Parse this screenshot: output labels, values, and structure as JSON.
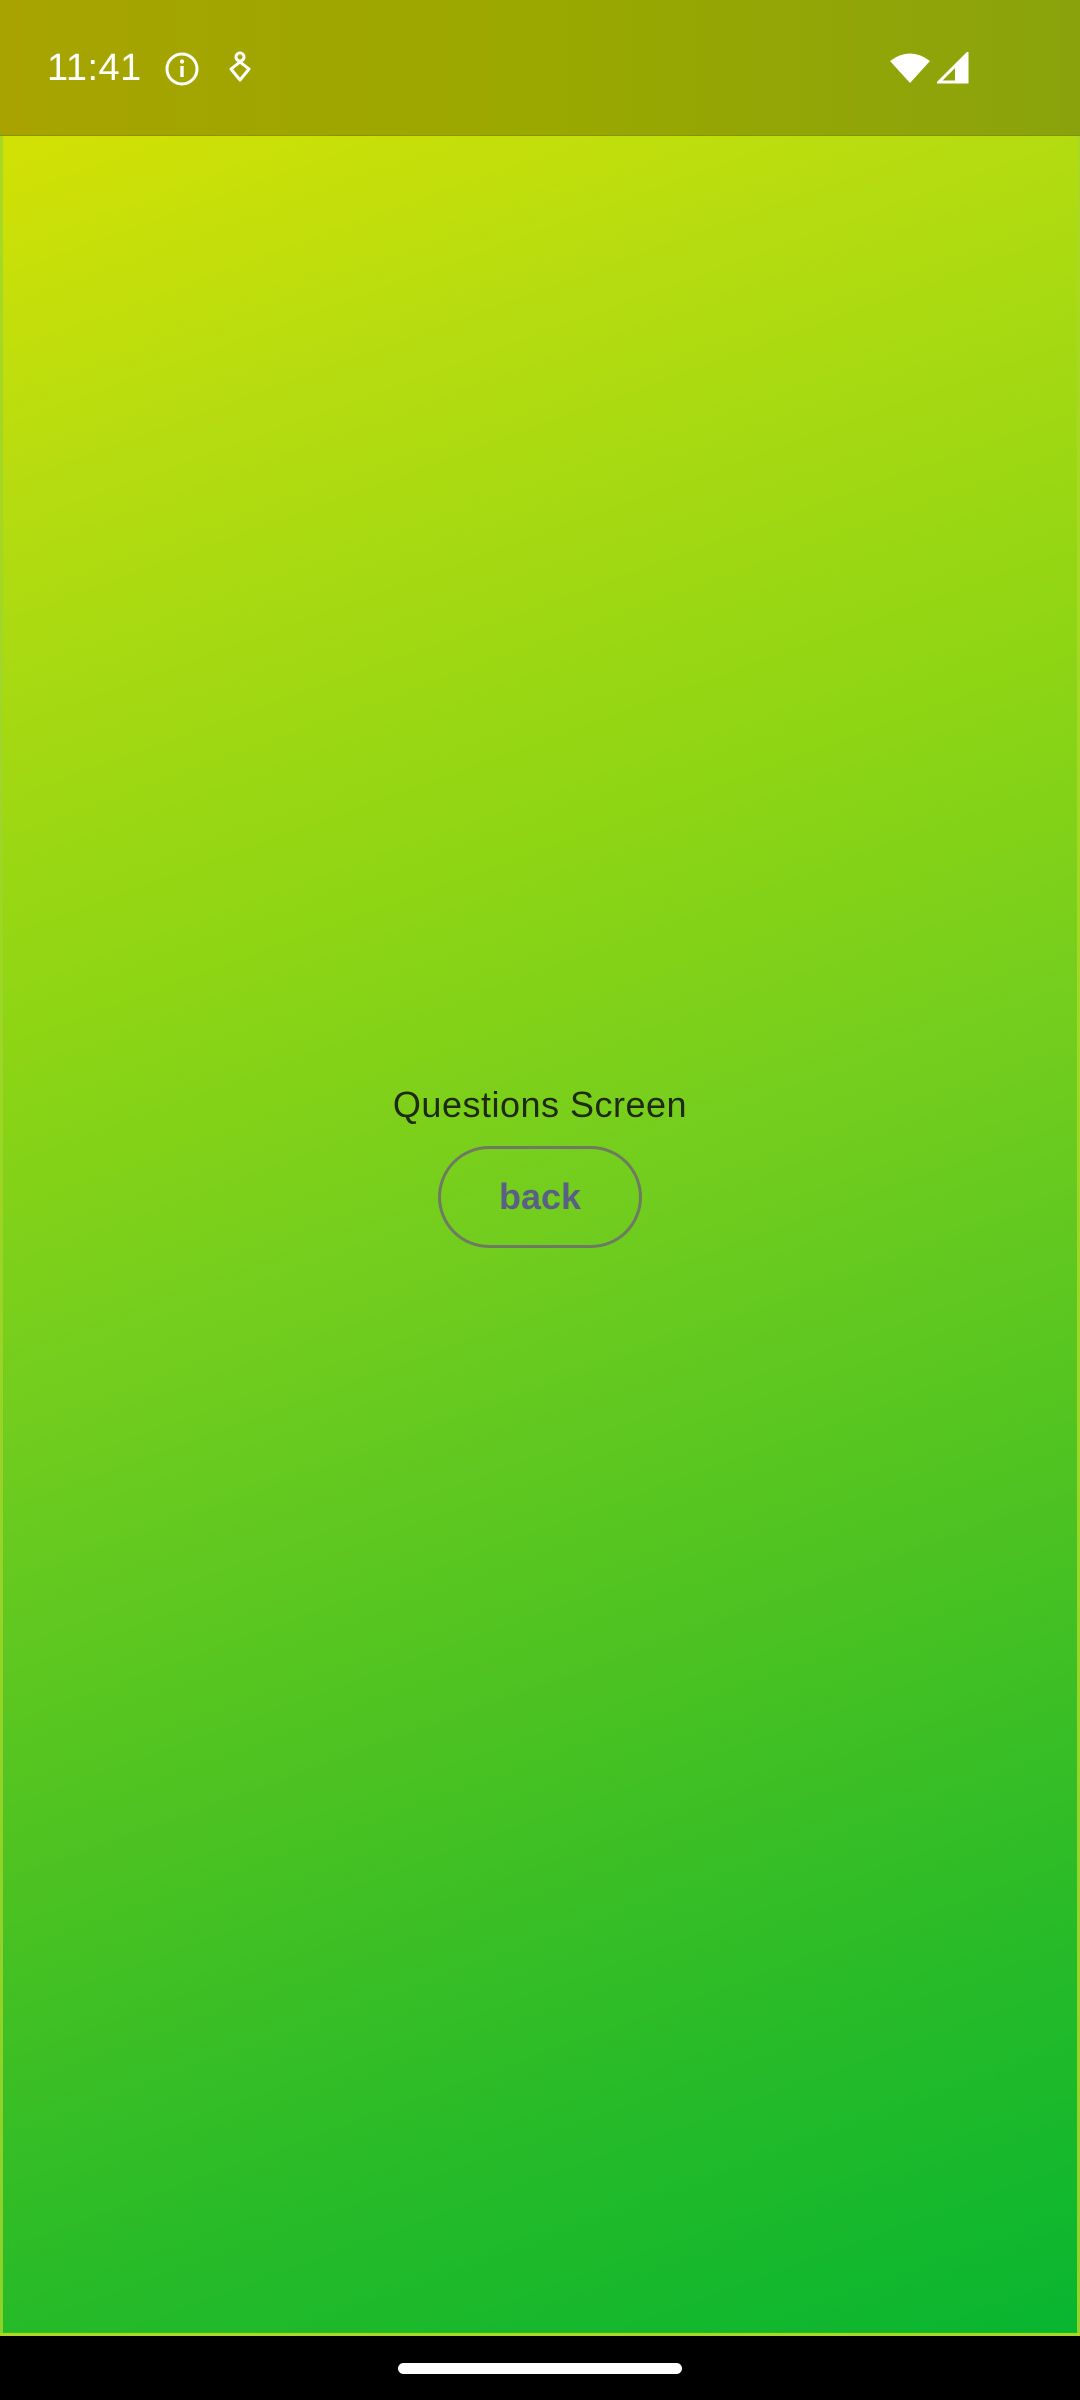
{
  "status_bar": {
    "time": "11:41",
    "icons": [
      "info-icon",
      "pin-icon",
      "wifi-icon",
      "signal-icon"
    ]
  },
  "main": {
    "title": "Questions Screen",
    "back_button_label": "back"
  },
  "colors": {
    "gradient_top": "#dde300",
    "gradient_bottom": "#08b630",
    "status_bar": "#9aa800",
    "button_text": "#5a5f86",
    "button_border": "#6e7a62",
    "title_text": "#1f2a12"
  }
}
